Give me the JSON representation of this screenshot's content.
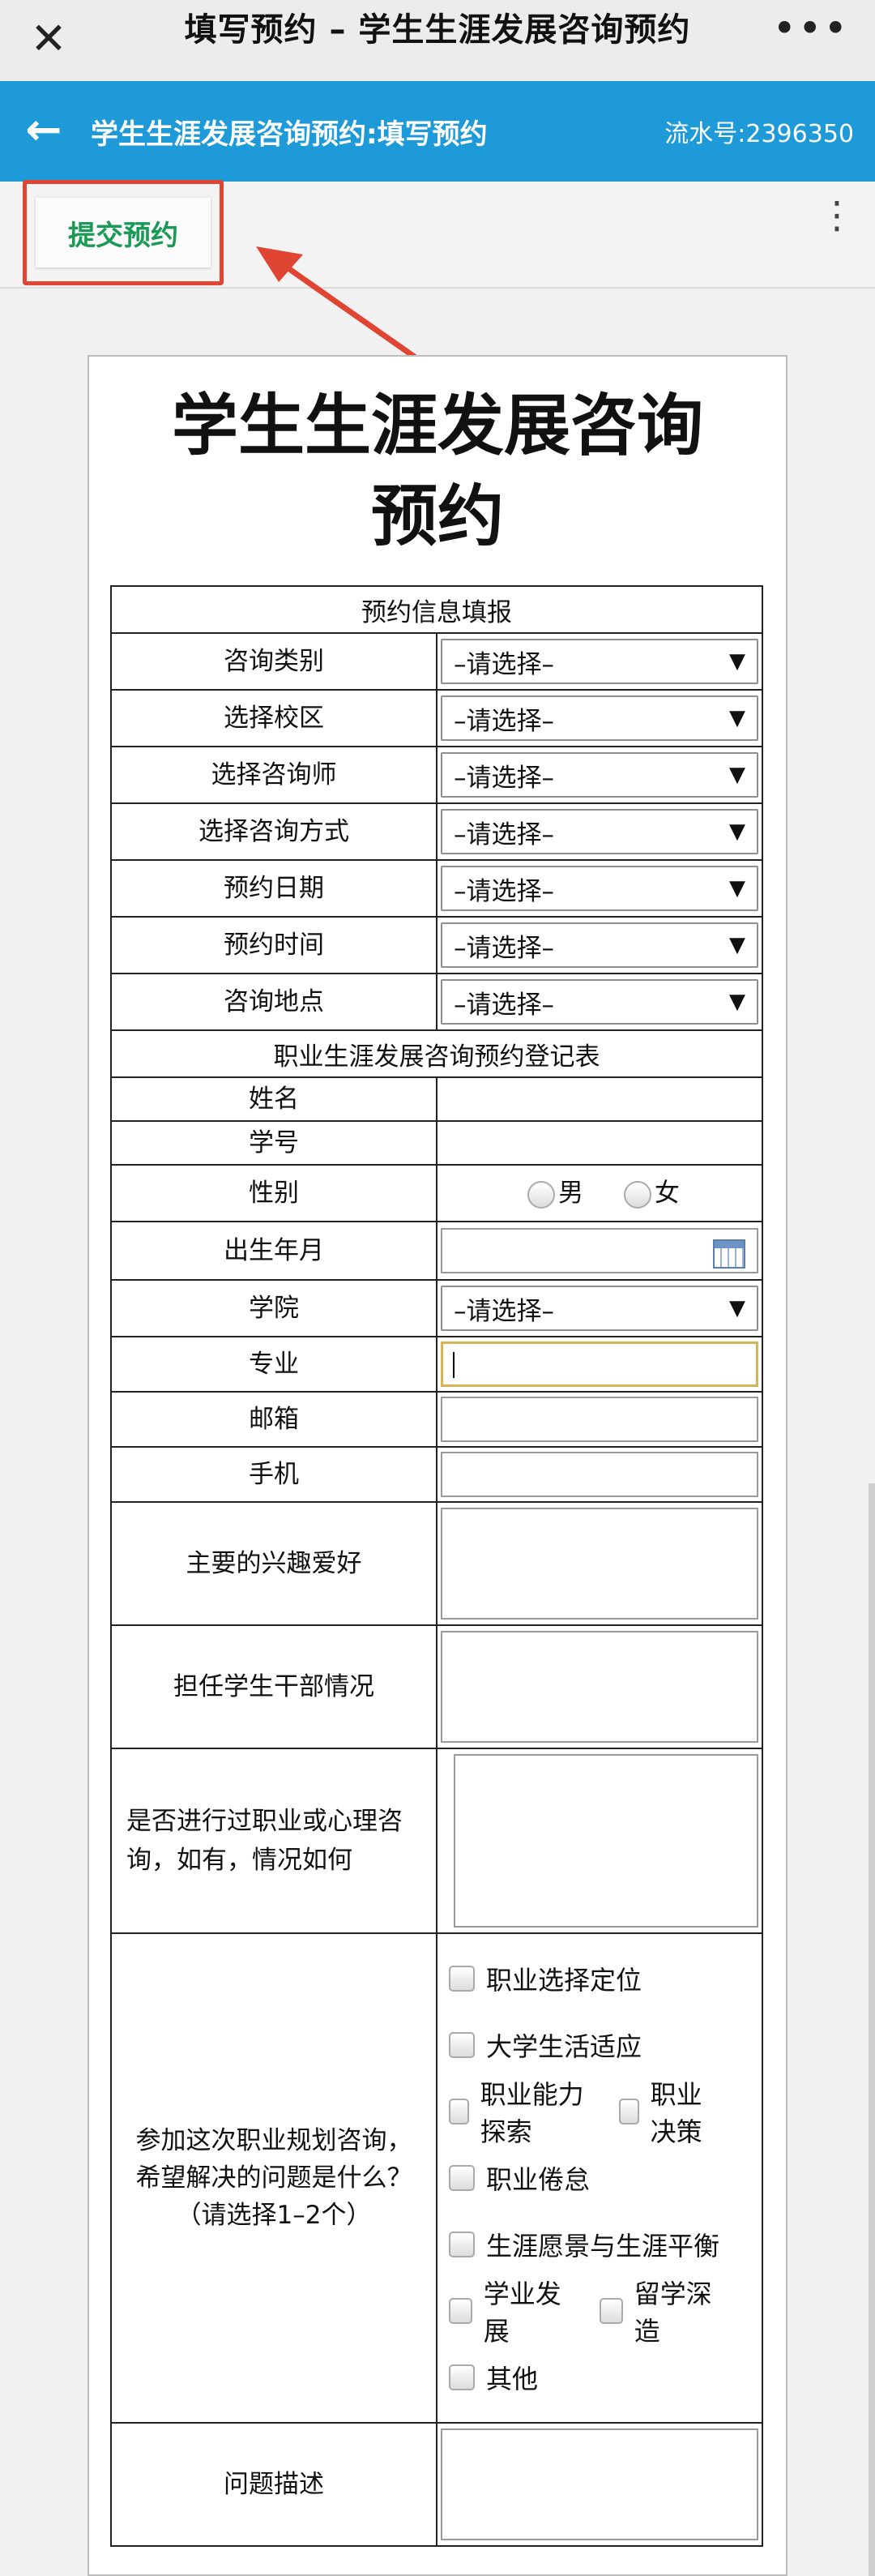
{
  "topbar": {
    "title": "填写预约 – 学生生涯发展咨询预约",
    "close_icon": "close-icon",
    "more_icon": "more-horizontal-icon"
  },
  "appbar": {
    "title": "学生生涯发展咨询预约:填写预约",
    "serial": "流水号:2396350",
    "back_icon": "back-arrow-icon"
  },
  "toolbar": {
    "submit_label": "提交预约",
    "menu_icon": "more-vertical-icon"
  },
  "doc_title": "学生生涯发展咨询预约",
  "section1": {
    "header": "预约信息填报",
    "fields": [
      {
        "label": "咨询类别",
        "value": "–请选择–"
      },
      {
        "label": "选择校区",
        "value": "–请选择–"
      },
      {
        "label": "选择咨询师",
        "value": "–请选择–"
      },
      {
        "label": "选择咨询方式",
        "value": "–请选择–"
      },
      {
        "label": "预约日期",
        "value": "–请选择–"
      },
      {
        "label": "预约时间",
        "value": "–请选择–"
      },
      {
        "label": "咨询地点",
        "value": "–请选择–"
      }
    ]
  },
  "section2": {
    "header": "职业生涯发展咨询预约登记表",
    "name_label": "姓名",
    "student_id_label": "学号",
    "gender_label": "性别",
    "gender_options": [
      "男",
      "女"
    ],
    "birth_label": "出生年月",
    "college_label": "学院",
    "college_value": "–请选择–",
    "major_label": "专业",
    "email_label": "邮箱",
    "phone_label": "手机",
    "hobbies_label": "主要的兴趣爱好",
    "cadre_label": "担任学生干部情况",
    "prior_label": "是否进行过职业或心理咨询，如有，情况如何",
    "goals_label": "参加这次职业规划咨询，希望解决的问题是什么？（请选择1–2个）",
    "goals_options": [
      "职业选择定位",
      "大学生活适应",
      "职业能力探索",
      "职业决策",
      "职业倦怠",
      "生涯愿景与生涯平衡",
      "学业发展",
      "留学深造",
      "其他"
    ],
    "desc_label": "问题描述"
  },
  "colors": {
    "appbar": "#1e9ad9",
    "submit_text": "#199a55",
    "highlight": "#e04432"
  }
}
